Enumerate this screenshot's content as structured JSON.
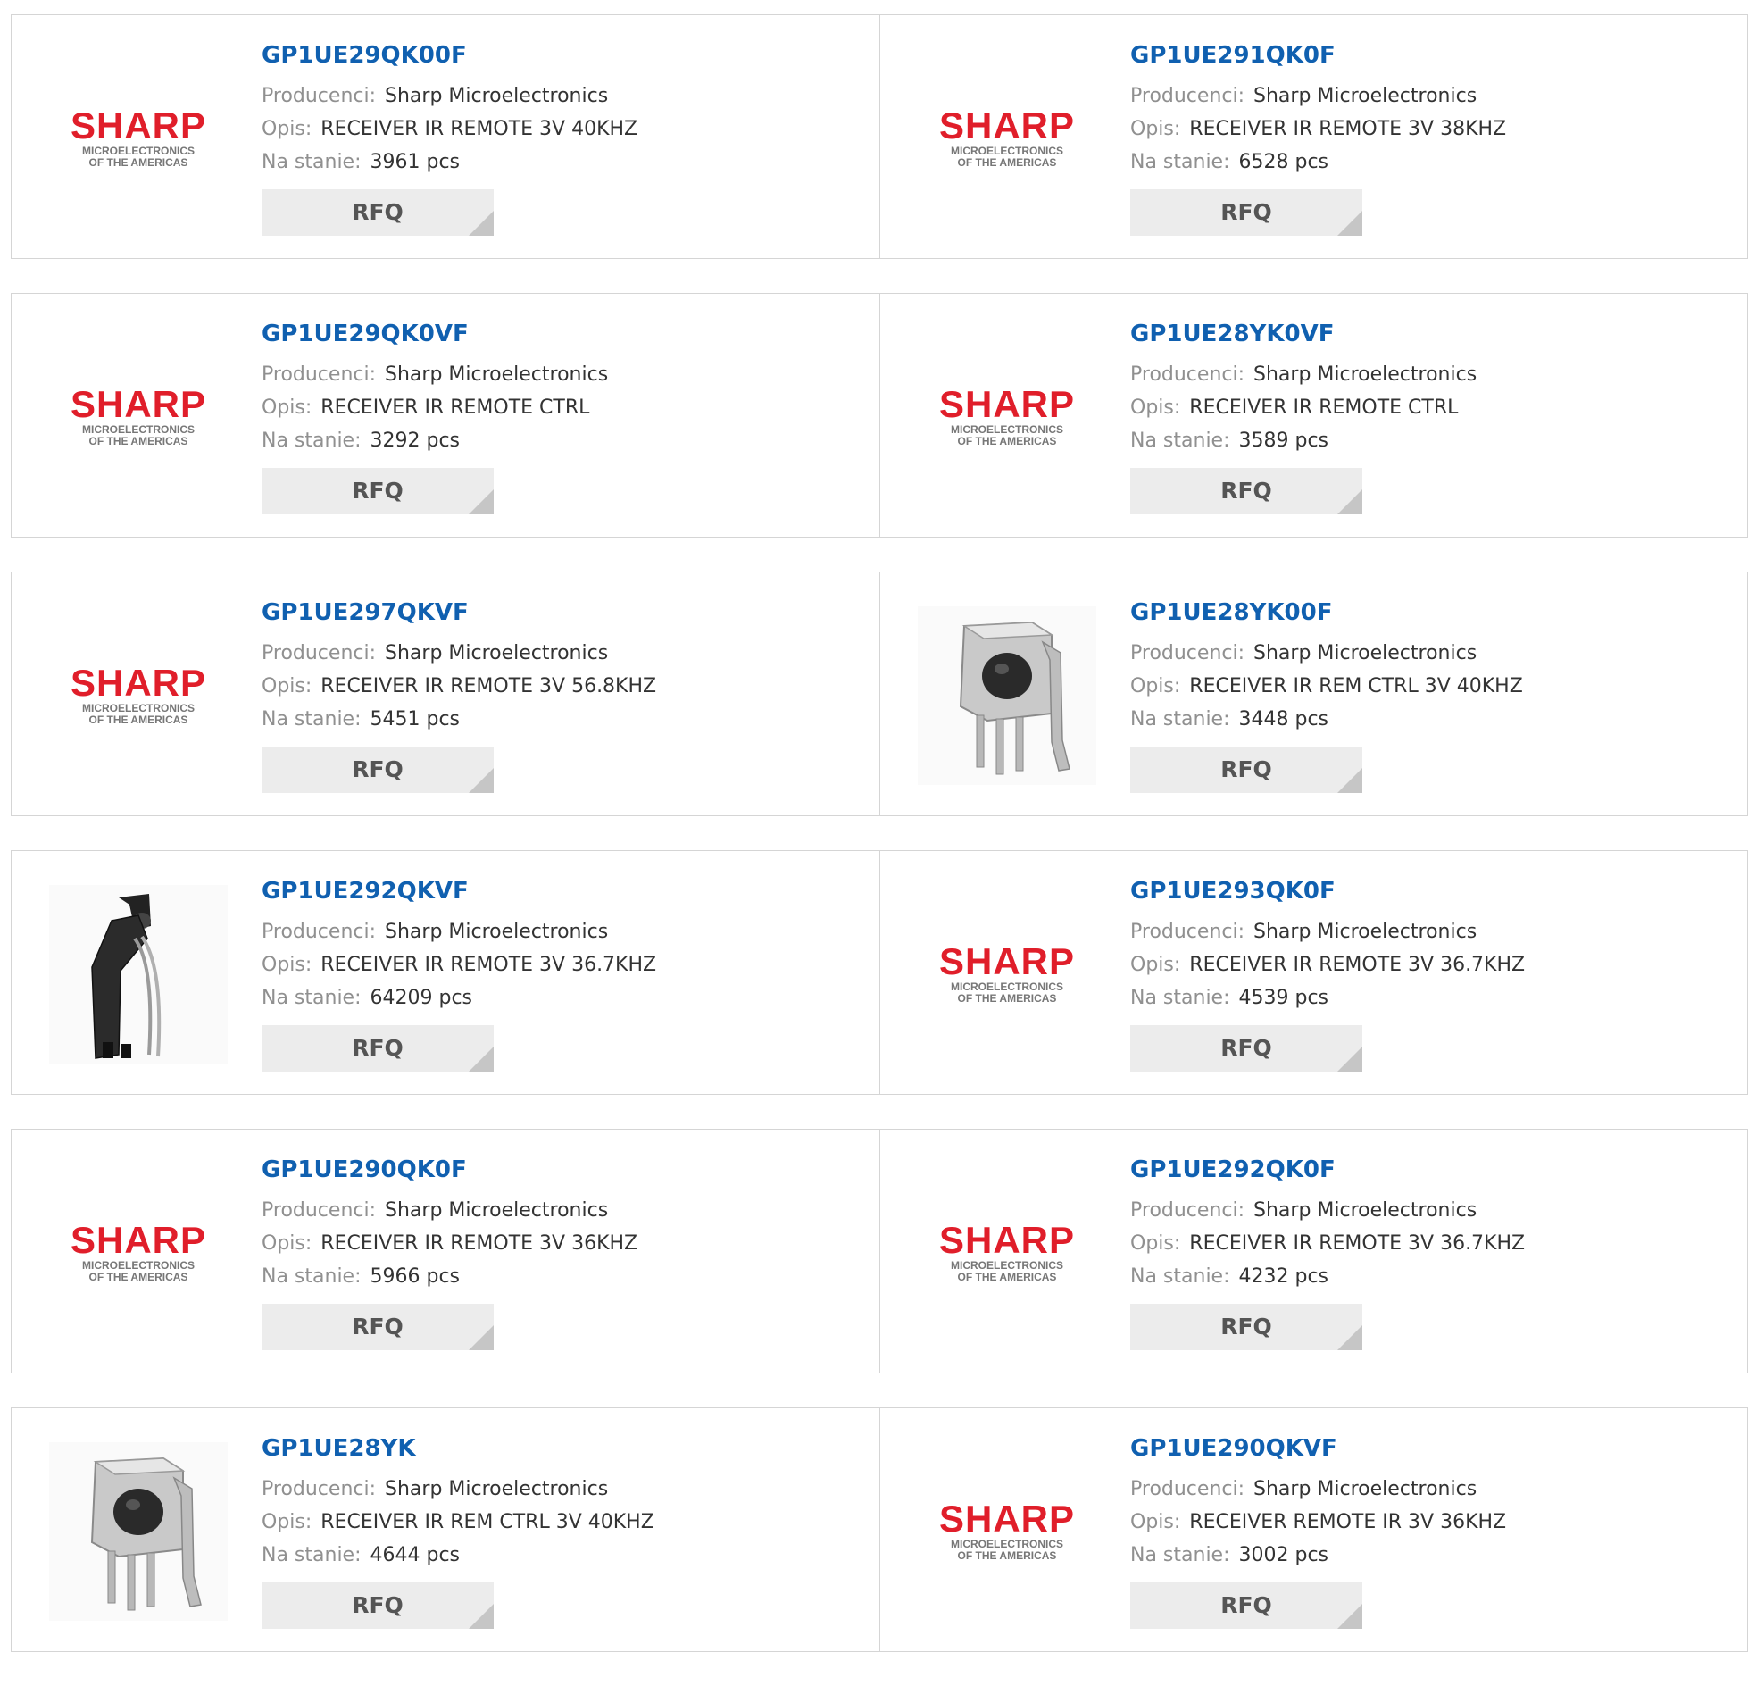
{
  "labels": {
    "manufacturer": "Producenci:",
    "description": "Opis:",
    "stock": "Na stanie:",
    "rfq": "RFQ"
  },
  "logo": {
    "brand": "SHARP",
    "sub1": "MICROELECTRONICS",
    "sub2": "OF THE AMERICAS"
  },
  "colors": {
    "title": "#1060b0",
    "brand_red": "#e01e2a",
    "rfq_bg": "#ececec"
  },
  "products": [
    {
      "part": "GP1UE29QK00F",
      "manufacturer": "Sharp Microelectronics",
      "description": "RECEIVER IR REMOTE 3V 40KHZ",
      "stock": "3961 pcs",
      "image": "sharp-logo"
    },
    {
      "part": "GP1UE291QK0F",
      "manufacturer": "Sharp Microelectronics",
      "description": "RECEIVER IR REMOTE 3V 38KHZ",
      "stock": "6528 pcs",
      "image": "sharp-logo"
    },
    {
      "part": "GP1UE29QK0VF",
      "manufacturer": "Sharp Microelectronics",
      "description": "RECEIVER IR REMOTE CTRL",
      "stock": "3292 pcs",
      "image": "sharp-logo"
    },
    {
      "part": "GP1UE28YK0VF",
      "manufacturer": "Sharp Microelectronics",
      "description": "RECEIVER IR REMOTE CTRL",
      "stock": "3589 pcs",
      "image": "sharp-logo"
    },
    {
      "part": "GP1UE297QKVF",
      "manufacturer": "Sharp Microelectronics",
      "description": "RECEIVER IR REMOTE 3V 56.8KHZ",
      "stock": "5451 pcs",
      "image": "sharp-logo"
    },
    {
      "part": "GP1UE28YK00F",
      "manufacturer": "Sharp Microelectronics",
      "description": "RECEIVER IR REM CTRL 3V 40KHZ",
      "stock": "3448 pcs",
      "image": "metal-sensor-photo"
    },
    {
      "part": "GP1UE292QKVF",
      "manufacturer": "Sharp Microelectronics",
      "description": "RECEIVER IR REMOTE 3V 36.7KHZ",
      "stock": "64209 pcs",
      "image": "black-sensor-photo"
    },
    {
      "part": "GP1UE293QK0F",
      "manufacturer": "Sharp Microelectronics",
      "description": "RECEIVER IR REMOTE 3V 36.7KHZ",
      "stock": "4539 pcs",
      "image": "sharp-logo"
    },
    {
      "part": "GP1UE290QK0F",
      "manufacturer": "Sharp Microelectronics",
      "description": "RECEIVER IR REMOTE 3V 36KHZ",
      "stock": "5966 pcs",
      "image": "sharp-logo"
    },
    {
      "part": "GP1UE292QK0F",
      "manufacturer": "Sharp Microelectronics",
      "description": "RECEIVER IR REMOTE 3V 36.7KHZ",
      "stock": "4232 pcs",
      "image": "sharp-logo"
    },
    {
      "part": "GP1UE28YK",
      "manufacturer": "Sharp Microelectronics",
      "description": "RECEIVER IR REM CTRL 3V 40KHZ",
      "stock": "4644 pcs",
      "image": "metal-sensor-photo"
    },
    {
      "part": "GP1UE290QKVF",
      "manufacturer": "Sharp Microelectronics",
      "description": "RECEIVER REMOTE IR 3V 36KHZ",
      "stock": "3002 pcs",
      "image": "sharp-logo"
    }
  ]
}
